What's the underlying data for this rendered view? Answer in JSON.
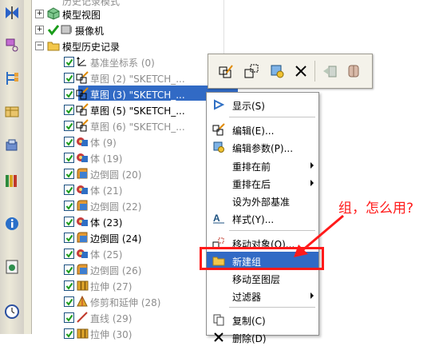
{
  "tree": {
    "items": [
      {
        "label": "历史记录模式",
        "kind": "clipped"
      },
      {
        "label": "模型视图",
        "kind": "node"
      },
      {
        "label": "摄像机",
        "kind": "node"
      },
      {
        "label": "模型历史记录",
        "kind": "node"
      }
    ],
    "features": [
      {
        "label": "基准坐标系 (0)",
        "icon": "datum-csys-icon",
        "state": "inactive"
      },
      {
        "label": "草图 (2) \"SKETCH_...",
        "icon": "sketch-icon",
        "state": "inactive"
      },
      {
        "label": "草图 (3) \"SKETCH_...",
        "icon": "sketch-icon",
        "state": "selected"
      },
      {
        "label": "草图 (5) \"SKETCH_...",
        "icon": "sketch-icon",
        "state": "active"
      },
      {
        "label": "草图 (6) \"SKETCH_...",
        "icon": "sketch-icon",
        "state": "inactive"
      },
      {
        "label": "体 (9)",
        "icon": "body-icon",
        "state": "inactive"
      },
      {
        "label": "体 (19)",
        "icon": "body-icon",
        "state": "inactive"
      },
      {
        "label": "边倒圆 (20)",
        "icon": "edge-blend-icon",
        "state": "inactive"
      },
      {
        "label": "体 (21)",
        "icon": "body-icon",
        "state": "inactive"
      },
      {
        "label": "边倒圆 (22)",
        "icon": "edge-blend-icon",
        "state": "inactive"
      },
      {
        "label": "体 (23)",
        "icon": "body-icon",
        "state": "active"
      },
      {
        "label": "边倒圆 (24)",
        "icon": "edge-blend-icon",
        "state": "active"
      },
      {
        "label": "体 (25)",
        "icon": "body-icon",
        "state": "inactive"
      },
      {
        "label": "边倒圆 (26)",
        "icon": "edge-blend-icon",
        "state": "inactive"
      },
      {
        "label": "拉伸 (27)",
        "icon": "extrude-icon",
        "state": "inactive"
      },
      {
        "label": "修剪和延伸 (28)",
        "icon": "trim-extend-icon",
        "state": "inactive"
      },
      {
        "label": "直线 (29)",
        "icon": "line-icon",
        "state": "inactive"
      },
      {
        "label": "拉伸 (30)",
        "icon": "extrude-icon",
        "state": "inactive"
      }
    ]
  },
  "toolbar": {
    "buttons": [
      "edit-sketch-icon",
      "make-current-icon",
      "edit-parameters-icon",
      "delete-icon",
      "move-feature-icon",
      "body-display-icon"
    ]
  },
  "menu": {
    "items": [
      {
        "label": "显示(S)",
        "icon": "show-icon",
        "submenu": false
      },
      {
        "label": "编辑(E)...",
        "icon": "edit-icon",
        "submenu": false
      },
      {
        "label": "编辑参数(P)...",
        "icon": "edit-parameters-icon",
        "submenu": false
      },
      {
        "label": "重排在前",
        "icon": "",
        "submenu": true
      },
      {
        "label": "重排在后",
        "icon": "",
        "submenu": true
      },
      {
        "label": "设为外部基准",
        "icon": "",
        "submenu": false
      },
      {
        "label": "样式(Y)...",
        "icon": "style-icon",
        "submenu": false
      },
      {
        "label": "移动对象(O)...",
        "icon": "move-object-icon",
        "submenu": false
      },
      {
        "label": "新建组",
        "icon": "folder-icon",
        "submenu": false,
        "highlighted": true
      },
      {
        "label": "移动至图层",
        "icon": "",
        "submenu": false
      },
      {
        "label": "过滤器",
        "icon": "",
        "submenu": true
      },
      {
        "label": "复制(C)",
        "icon": "copy-icon",
        "submenu": false
      },
      {
        "label": "删除(D)",
        "icon": "delete-icon",
        "submenu": false
      }
    ]
  },
  "annotation": {
    "text": "组，怎么用?",
    "color": "#ff1a1a"
  },
  "colors": {
    "selection": "#316ac5",
    "checkbox_check": "#1a9c1a",
    "annotation": "#ff1a1a"
  }
}
